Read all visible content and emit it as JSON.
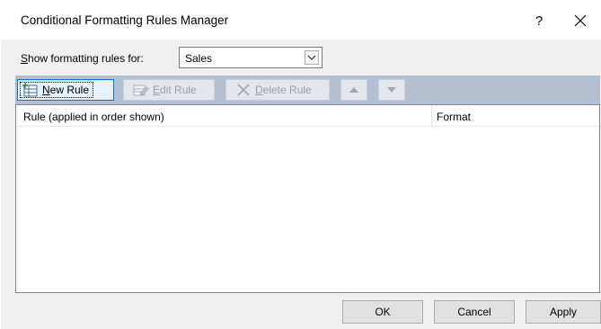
{
  "dialog": {
    "title": "Conditional Formatting Rules Manager",
    "help_label": "?",
    "close_label": "✕"
  },
  "show_rules": {
    "label_mnemonic": "S",
    "label_rest": "how formatting rules for:",
    "selected_value": "Sales"
  },
  "toolbar": {
    "new_rule": {
      "mnemonic": "N",
      "rest": "ew Rule"
    },
    "edit_rule": {
      "mnemonic": "E",
      "rest": "dit Rule"
    },
    "delete_rule": {
      "mnemonic": "D",
      "rest": "elete Rule"
    }
  },
  "rules_list": {
    "columns": [
      "Rule (applied in order shown)",
      "Format"
    ]
  },
  "buttons": {
    "ok": "OK",
    "cancel": "Cancel",
    "apply": "Apply"
  },
  "colors": {
    "toolbar_bg": "#b4bfcf",
    "focus_border": "#0078d7",
    "dialog_bg": "#f0f0f0"
  }
}
